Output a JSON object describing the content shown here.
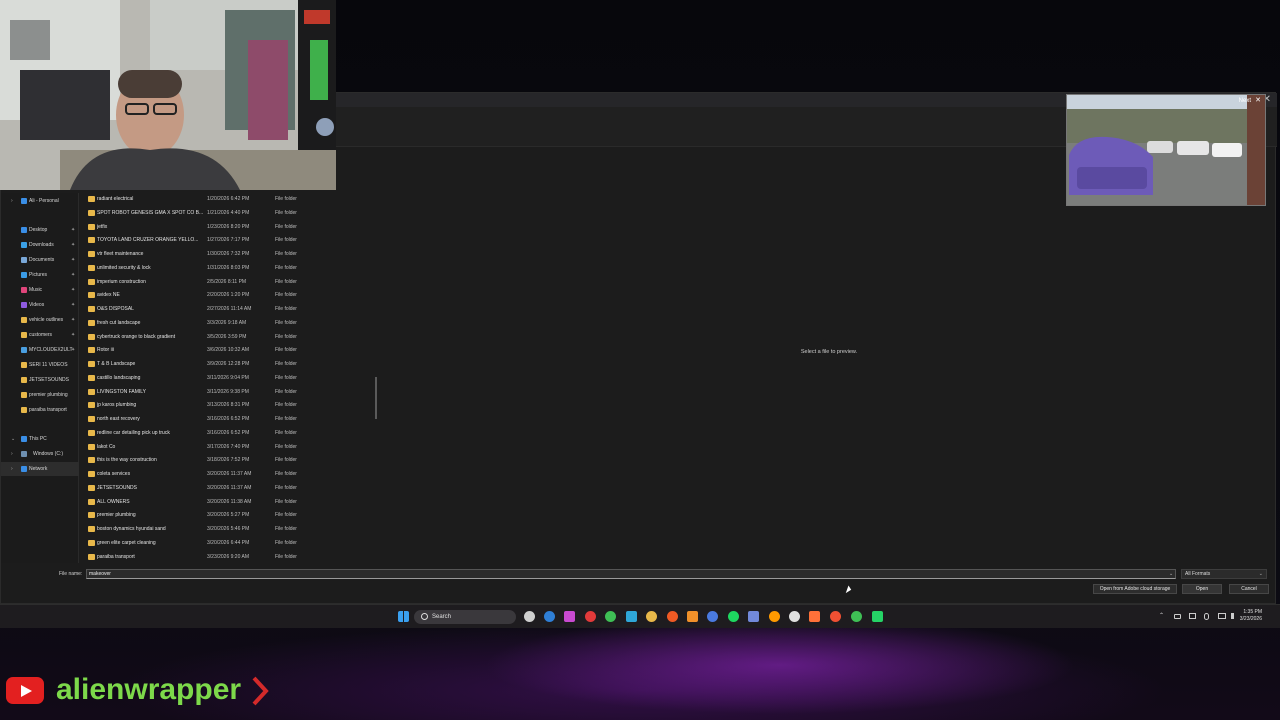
{
  "dialog": {
    "close_glyph": "✕",
    "nav": [
      {
        "label": "Ali - Personal",
        "color": "#3a8ee6",
        "chevron": "›",
        "pin": false,
        "selected": false
      },
      {
        "label": "Desktop",
        "color": "#3a8ee6",
        "chevron": "",
        "pin": true,
        "selected": false
      },
      {
        "label": "Downloads",
        "color": "#3aa0e6",
        "chevron": "",
        "pin": true,
        "selected": false
      },
      {
        "label": "Documents",
        "color": "#7aa8d8",
        "chevron": "",
        "pin": true,
        "selected": false
      },
      {
        "label": "Pictures",
        "color": "#3a9be6",
        "chevron": "",
        "pin": true,
        "selected": false
      },
      {
        "label": "Music",
        "color": "#e0457b",
        "chevron": "",
        "pin": true,
        "selected": false
      },
      {
        "label": "Videos",
        "color": "#8f5be0",
        "chevron": "",
        "pin": true,
        "selected": false
      },
      {
        "label": "vehicle outlines",
        "color": "#e8b84a",
        "chevron": "",
        "pin": true,
        "selected": false
      },
      {
        "label": "customers",
        "color": "#e8b84a",
        "chevron": "",
        "pin": true,
        "selected": false
      },
      {
        "label": "MYCLOUDEX2ULT",
        "color": "#4a9fe0",
        "chevron": "",
        "pin": true,
        "selected": false
      },
      {
        "label": "SERI 11 VIDEOS",
        "color": "#e8b84a",
        "chevron": "",
        "pin": false,
        "selected": false
      },
      {
        "label": "JETSETSOUNDS",
        "color": "#e8b84a",
        "chevron": "",
        "pin": false,
        "selected": false
      },
      {
        "label": "premier plumbing",
        "color": "#e8b84a",
        "chevron": "",
        "pin": false,
        "selected": false
      },
      {
        "label": "paraiba transport",
        "color": "#e8b84a",
        "chevron": "",
        "pin": false,
        "selected": false
      },
      {
        "label": "This PC",
        "color": "#3a8ee6",
        "chevron": "⌄",
        "pin": false,
        "selected": false
      },
      {
        "label": "Windows (C:)",
        "color": "#6e8fb0",
        "chevron": "›",
        "pin": false,
        "selected": false
      },
      {
        "label": "Network",
        "color": "#3a8ee6",
        "chevron": "›",
        "pin": false,
        "selected": true
      }
    ],
    "files": [
      {
        "name": "radiant electrical",
        "date": "1/20/2026 6:42 PM",
        "type": "File folder"
      },
      {
        "name": "SPOT ROBOT GENESIS GMA X SPOT CO B...",
        "date": "1/21/2026 4:40 PM",
        "type": "File folder"
      },
      {
        "name": "jetfix",
        "date": "1/23/2026 8:20 PM",
        "type": "File folder"
      },
      {
        "name": "TOYOTA LAND CRUZER ORANGE YELLO...",
        "date": "1/27/2026 7:17 PM",
        "type": "File folder"
      },
      {
        "name": "vtr fleet maintenance",
        "date": "1/30/2026 7:32 PM",
        "type": "File folder"
      },
      {
        "name": "unlimited security & lock",
        "date": "1/31/2026 8:03 PM",
        "type": "File folder"
      },
      {
        "name": "imperium construction",
        "date": "2/5/2026 8:11 PM",
        "type": "File folder"
      },
      {
        "name": "avidex NE",
        "date": "2/20/2026 1:20 PM",
        "type": "File folder"
      },
      {
        "name": "O&S DISPOSAL",
        "date": "2/27/2026 11:14 AM",
        "type": "File folder"
      },
      {
        "name": "fresh cut landscape",
        "date": "3/3/2026 9:18 AM",
        "type": "File folder"
      },
      {
        "name": "cybertruck orange to black gradient",
        "date": "3/5/2026 3:59 PM",
        "type": "File folder"
      },
      {
        "name": "Rotor iii",
        "date": "3/6/2026 10:32 AM",
        "type": "File folder"
      },
      {
        "name": "T & B Landscape",
        "date": "3/9/2026 12:28 PM",
        "type": "File folder"
      },
      {
        "name": "castillo landscaping",
        "date": "3/11/2026 9:04 PM",
        "type": "File folder"
      },
      {
        "name": "LIVINGSTON FAMILY",
        "date": "3/11/2026 9:38 PM",
        "type": "File folder"
      },
      {
        "name": "jp karos plumbing",
        "date": "3/13/2026 8:31 PM",
        "type": "File folder"
      },
      {
        "name": "north east recovery",
        "date": "3/16/2026 6:52 PM",
        "type": "File folder"
      },
      {
        "name": "redline car detailing pick up truck",
        "date": "3/16/2026 6:52 PM",
        "type": "File folder"
      },
      {
        "name": "lakot Co",
        "date": "3/17/2026 7:40 PM",
        "type": "File folder"
      },
      {
        "name": "this is the way construction",
        "date": "3/18/2026 7:52 PM",
        "type": "File folder"
      },
      {
        "name": "coleta services",
        "date": "3/20/2026 11:37 AM",
        "type": "File folder"
      },
      {
        "name": "JETSETSOUNDS",
        "date": "3/20/2026 11:37 AM",
        "type": "File folder"
      },
      {
        "name": "ALL OWNERS",
        "date": "3/20/2026 11:38 AM",
        "type": "File folder"
      },
      {
        "name": "premier plumbing",
        "date": "3/20/2026 5:27 PM",
        "type": "File folder"
      },
      {
        "name": "boston dynamics hyundai sand",
        "date": "3/20/2026 5:46 PM",
        "type": "File folder"
      },
      {
        "name": "green elite carpet cleaning",
        "date": "3/20/2026 6:44 PM",
        "type": "File folder"
      },
      {
        "name": "paraiba transport",
        "date": "3/23/2026 9:20 AM",
        "type": "File folder"
      }
    ],
    "preview_text": "Select a file to preview.",
    "file_name_label": "File name:",
    "file_name_value": "makeover",
    "file_name_dropdown": "⌄",
    "formats_value": "All Formats",
    "formats_arrow": "⌄",
    "cloud_button": "Open from Adobe cloud storage",
    "open_button": "Open",
    "cancel_button": "Cancel"
  },
  "thumbnail": {
    "next_label": "Next",
    "close_glyph": "✕"
  },
  "taskbar": {
    "search_label": "Search",
    "icons": [
      {
        "name": "windows-start-icon",
        "color": "#3aa0f0"
      },
      {
        "name": "task-view-icon",
        "color": "#cfcfcf"
      },
      {
        "name": "mail-icon",
        "color": "#2f7fd6"
      },
      {
        "name": "instagram-icon",
        "color": "#c94ad0"
      },
      {
        "name": "chrome-red-icon",
        "color": "#e23a3a"
      },
      {
        "name": "chrome-icon",
        "color": "#3fbf55"
      },
      {
        "name": "edge-icon",
        "color": "#2fa7d8"
      },
      {
        "name": "file-explorer-icon",
        "color": "#e8b84a"
      },
      {
        "name": "brave-icon",
        "color": "#f05a24"
      },
      {
        "name": "blender-icon",
        "color": "#f0902a"
      },
      {
        "name": "app-icon",
        "color": "#4a7ae0"
      },
      {
        "name": "spotify-icon",
        "color": "#1ed760"
      },
      {
        "name": "discord-icon",
        "color": "#7289da"
      },
      {
        "name": "illustrator-icon",
        "color": "#ff9a00"
      },
      {
        "name": "app-dark-icon",
        "color": "#e0e0e0"
      },
      {
        "name": "firefox-icon",
        "color": "#ff7139"
      },
      {
        "name": "git-icon",
        "color": "#f05033"
      },
      {
        "name": "chrome-alt-icon",
        "color": "#3fbf55"
      },
      {
        "name": "whatsapp-icon",
        "color": "#25d366"
      }
    ],
    "tray_chevron": "⌃",
    "time": "1:35 PM",
    "date": "3/23/2026"
  },
  "brand": {
    "name": "alienwrapper",
    "youtube_color": "#e32020",
    "green": "#7dd94a"
  }
}
